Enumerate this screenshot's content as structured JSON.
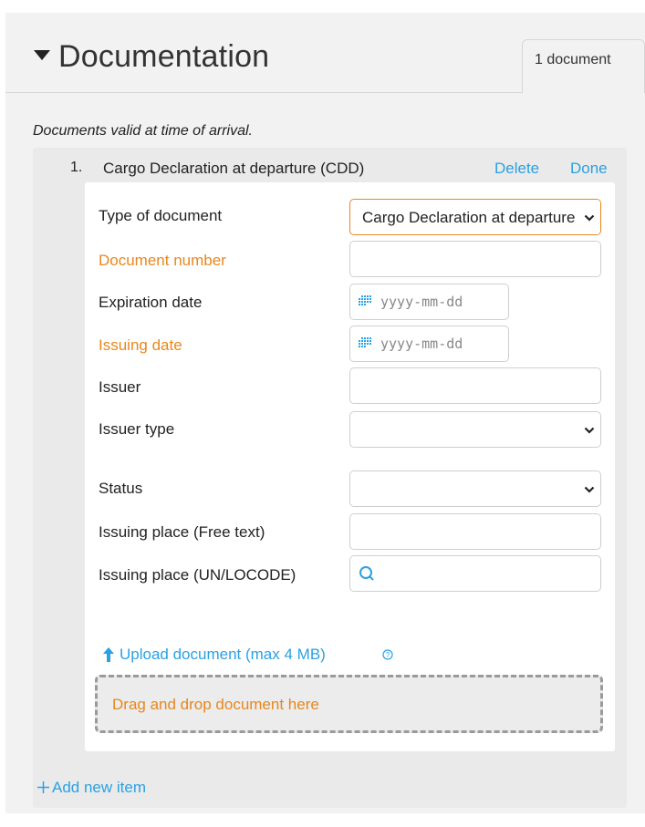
{
  "section": {
    "title": "Documentation",
    "tab_label": "1 document",
    "note": "Documents valid at time of arrival."
  },
  "item": {
    "number": "1.",
    "title": "Cargo Declaration at departure (CDD)",
    "delete_label": "Delete",
    "done_label": "Done"
  },
  "form": {
    "type_label": "Type of document",
    "type_value": "Cargo Declaration at departure (CDD)",
    "doc_number_label": "Document number",
    "doc_number_value": "",
    "expiration_label": "Expiration date",
    "expiration_placeholder": "yyyy-mm-dd",
    "issuing_date_label": "Issuing date",
    "issuing_date_placeholder": "yyyy-mm-dd",
    "issuer_label": "Issuer",
    "issuer_value": "",
    "issuer_type_label": "Issuer type",
    "issuer_type_value": "",
    "status_label": "Status",
    "status_value": "",
    "place_free_label": "Issuing place (Free text)",
    "place_free_value": "",
    "place_locode_label": "Issuing place (UN/LOCODE)",
    "place_locode_value": ""
  },
  "upload": {
    "label": "Upload document (max 4 MB)",
    "dropzone_text": "Drag and drop document here"
  },
  "add_item_label": "Add new item",
  "colors": {
    "link": "#2aa1e3",
    "required": "#e8871e",
    "panel": "#f2f2f2"
  },
  "icons": [
    "caret-down-icon",
    "calendar-icon",
    "search-icon",
    "upload-arrow-icon",
    "help-icon",
    "chevron-down-icon",
    "plus-icon"
  ]
}
